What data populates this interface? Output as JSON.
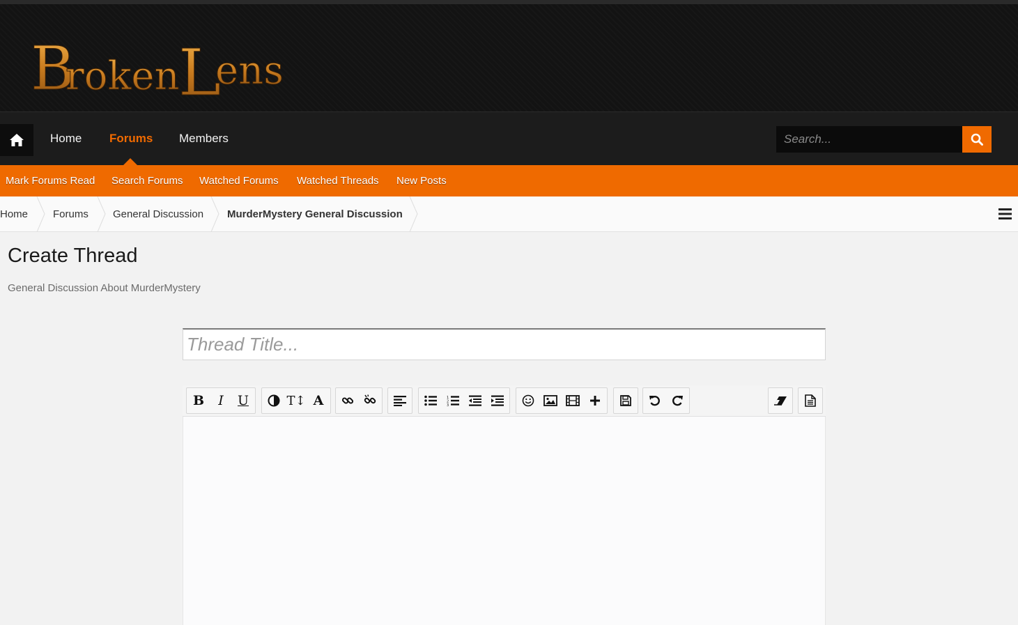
{
  "logo": {
    "text": "BrokenLens"
  },
  "nav": {
    "items": [
      {
        "label": "Home"
      },
      {
        "label": "Forums"
      },
      {
        "label": "Members"
      }
    ],
    "active": "Forums",
    "search_placeholder": "Search..."
  },
  "subnav": {
    "items": [
      {
        "label": "Mark Forums Read"
      },
      {
        "label": "Search Forums"
      },
      {
        "label": "Watched Forums"
      },
      {
        "label": "Watched Threads"
      },
      {
        "label": "New Posts"
      }
    ]
  },
  "breadcrumb": {
    "items": [
      {
        "label": "Home"
      },
      {
        "label": "Forums"
      },
      {
        "label": "General Discussion"
      },
      {
        "label": "MurderMystery General Discussion"
      }
    ]
  },
  "page": {
    "title": "Create Thread",
    "subtitle": "General Discussion About MurderMystery"
  },
  "form": {
    "title_placeholder": "Thread Title...",
    "title_value": "",
    "body_value": ""
  },
  "toolbar": {
    "bold": "B",
    "italic": "I",
    "underline": "U",
    "font_size": "T↕",
    "font_family": "A"
  },
  "colors": {
    "accent": "#ef6a00",
    "header_bg": "#131313",
    "nav_bg": "#1c1c1c"
  }
}
